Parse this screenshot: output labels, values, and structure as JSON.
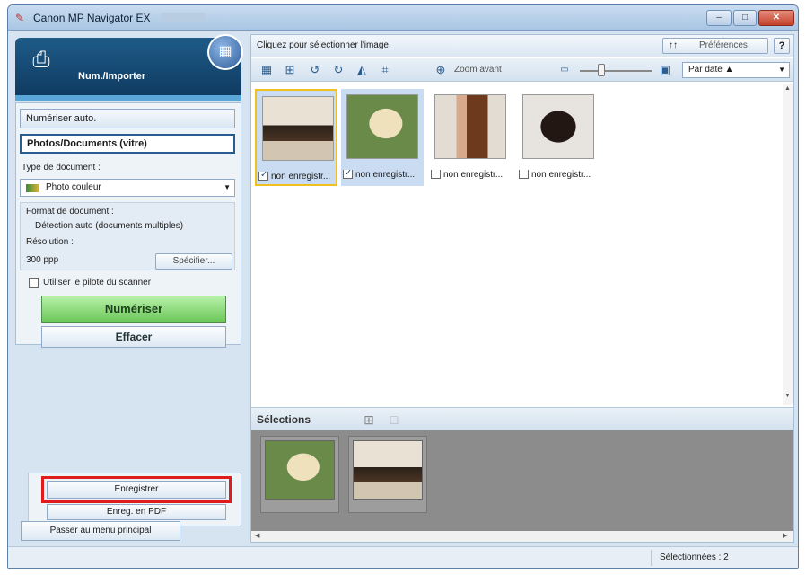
{
  "window": {
    "title": "Canon MP Navigator EX",
    "controls": {
      "minimize": "–",
      "maximize": "□",
      "close": "✕"
    }
  },
  "left_panel": {
    "mode_title": "Num./Importer",
    "tabs": {
      "auto": "Numériser auto.",
      "photo": "Photos/Documents (vitre)"
    },
    "doc_type_label": "Type de document :",
    "doc_type_value": "Photo couleur",
    "format_label": "Format de document :",
    "format_value": "Détection auto (documents multiples)",
    "resolution_label": "Résolution :",
    "resolution_value": "300 ppp",
    "specify_button": "Spécifier...",
    "driver_checkbox_label": "Utiliser le pilote du scanner",
    "scan_button": "Numériser",
    "clear_button": "Effacer",
    "save_button": "Enregistrer",
    "save_pdf_button": "Enreg. en PDF",
    "main_menu_button": "Passer au menu principal"
  },
  "right_panel": {
    "hint": "Cliquez pour sélectionner l'image.",
    "preferences_button": "Préférences",
    "preferences_icon_text": "↑↑",
    "help_button": "?",
    "zoom_label": "Zoom avant",
    "sort_value": "Par date  ▲",
    "thumbnails": [
      {
        "caption": "non enregistr...",
        "checked": true
      },
      {
        "caption": "non enregistr...",
        "checked": true
      },
      {
        "caption": "non enregistr...",
        "checked": false
      },
      {
        "caption": "non enregistr...",
        "checked": false
      }
    ],
    "selections_title": "Sélections"
  },
  "status": {
    "selected_count": "Sélectionnées : 2"
  },
  "colors": {
    "accent": "#1e5b88",
    "scan_green": "#6cc85a",
    "highlight_red": "#e01b1b"
  }
}
